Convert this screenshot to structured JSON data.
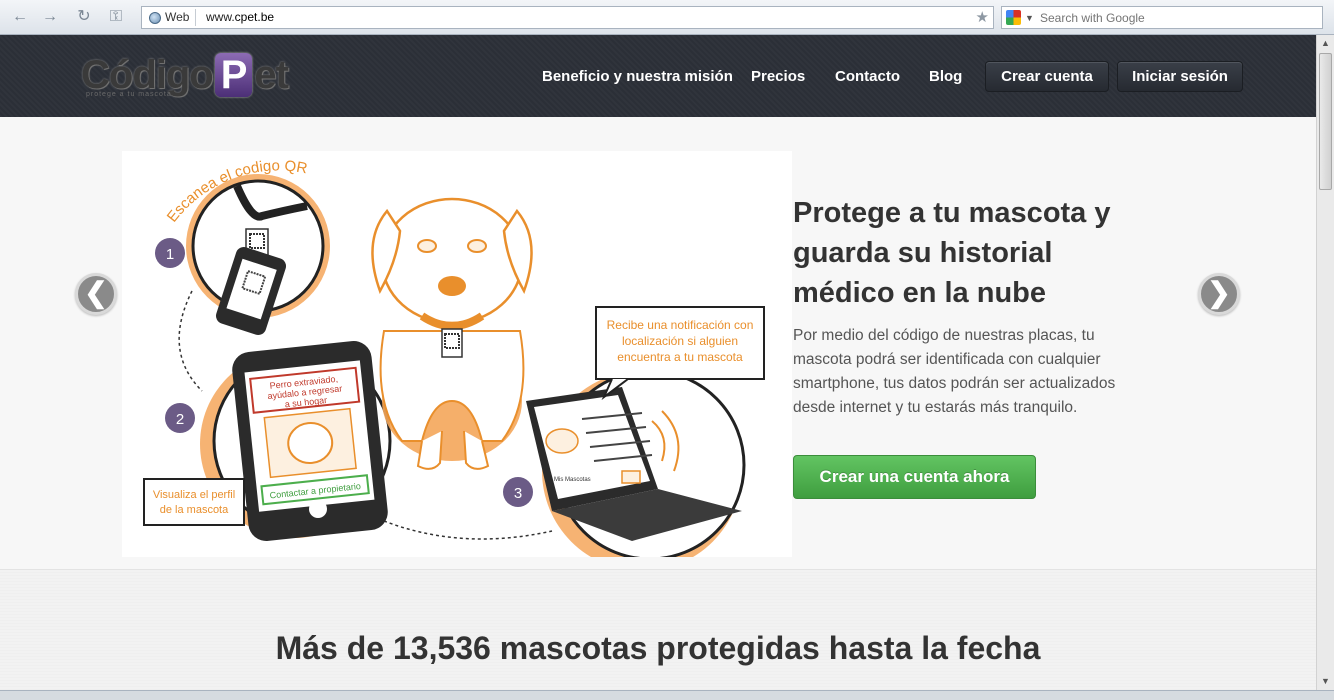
{
  "browser": {
    "web_label": "Web",
    "url_prefix": "www.",
    "url_domain": "cpet.be",
    "search_placeholder": "Search with Google"
  },
  "header": {
    "logo_text_left": "Código",
    "logo_text_p": "P",
    "logo_text_right": "et",
    "logo_tagline": "protege a tu mascota",
    "nav": [
      "Beneficio y nuestra misión",
      "Precios",
      "Contacto",
      "Blog"
    ],
    "signup_label": "Crear cuenta",
    "login_label": "Iniciar sesión"
  },
  "hero": {
    "prev_label": "❮",
    "next_label": "❯",
    "title": "Protege a tu mascota y guarda su historial médico en la nube",
    "text": "Por medio del código de nuestras placas, tu mascota podrá ser identificada con cualquier smartphone, tus datos podrán ser actualizados desde internet y tu estarás más tranquilo.",
    "cta_label": "Crear una cuenta ahora",
    "illustration": {
      "scan_label": "Escanea el codigo QR",
      "step1": "1",
      "step2": "2",
      "step3": "3",
      "phone_alert": [
        "Perro extraviado,",
        "ayúdalo a regresar",
        "a su hogar"
      ],
      "phone_button": "Contactar a propietario",
      "profile_note": [
        "Visualiza el perfil",
        "de la mascota"
      ],
      "notify_note": [
        "Recibe una notificación con",
        "localización si alguien",
        "encuentra a tu mascota"
      ],
      "laptop_heading": "Mis Mascotas"
    }
  },
  "stats": {
    "title": "Más de 13,536 mascotas protegidas hasta la fecha"
  },
  "colors": {
    "header_bg": "#2b2f37",
    "accent_orange": "#f0a04b",
    "accent_purple": "#6b5b86",
    "cta_green": "#4cae4c"
  }
}
